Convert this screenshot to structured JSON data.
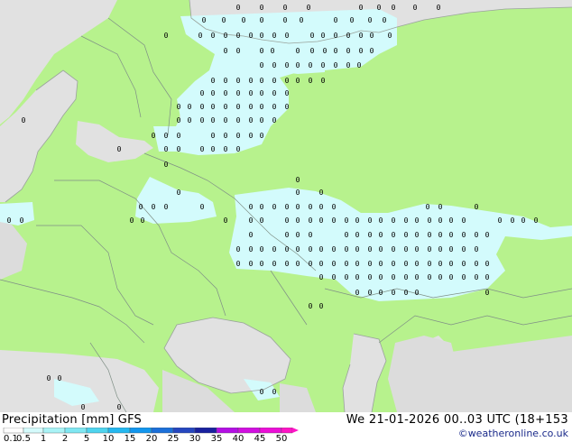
{
  "map": {
    "colors": {
      "land": "#b7f28d",
      "sea": "#e1e1e1",
      "land_no_data": "#dcdcdc",
      "light_precip": "#d3fbfc",
      "border": "#7f8f86",
      "coast": "#9aa39c",
      "marker": "#000000"
    },
    "marker_symbol": "0"
  },
  "footer": {
    "title": "Precipitation [mm]  GFS",
    "date": "We 21-01-2026 00..03 UTC (18+153",
    "copyright": "©weatheronline.co.uk"
  },
  "scale": {
    "labels": [
      "0.1",
      "0.5",
      "1",
      "2",
      "5",
      "10",
      "15",
      "20",
      "25",
      "30",
      "35",
      "40",
      "45",
      "50"
    ],
    "colors": [
      "#fefefe",
      "#d5fbfc",
      "#a9f3f6",
      "#7fe7f2",
      "#4ed4ee",
      "#24b8f0",
      "#1296ee",
      "#1b6fd9",
      "#2546bf",
      "#19219e",
      "#b30fe4",
      "#d10fe0",
      "#eb0fd7",
      "#ff14c6"
    ]
  }
}
